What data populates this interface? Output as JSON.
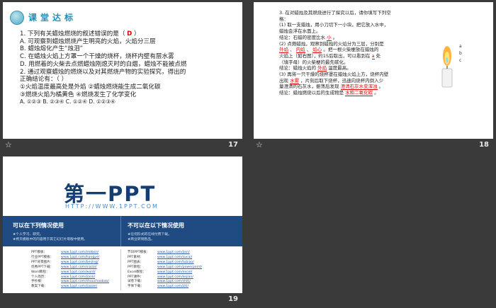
{
  "slide17": {
    "number": "17",
    "title": "课堂达标",
    "q1": "1. 下列有关蜡烛燃烧的叙述错误的是（",
    "q1_answer": "D",
    "q1_close": "）",
    "optA": "A. 可观察到蜡烛燃烧产生明亮的火焰，火焰分三层",
    "optB": "B. 蜡烛熔化产生“烛泪”",
    "optC": "C. 在蜡烛火焰上方罩一个干燥的烧杯，烧杯内壁有层水雾",
    "optD": "D. 用燃着的火柴去点燃蜡烛刚熄灭时的白烟，蜡烛不能被点燃",
    "q2a": "2. 通过观察蜡烛的燃烧以及对其燃烧产物的实验探究，得出的",
    "q2b": "正确结论有：（      ）",
    "c1": "①火焰温度最高处是外焰    ②蜡烛燃烧能生成二氧化碳",
    "c2": "③燃烧火焰为橘黄色            ④燃烧发生了化学变化",
    "opts": "A. ①②③          B. ②③④          C. ①②④          D. ①②③④"
  },
  "slide18": {
    "number": "18",
    "lines": [
      "3. 在对蜡烛及其燃烧进行了探究以后，请你填写下列空",
      "格：",
      "(1) 取一支蜡烛，用小刀切下一小块，把它放入水中，",
      "蜡烛会浮在水面上。",
      "结论：石蜡的密度比水____。",
      "(2) 点燃蜡烛，观察到蜡烛的火焰分为三层，分别是",
      "____、____、____。把一根火柴梗放在蜡烛的",
      "火焰上（如右图），约1S后取出，可以看到在____处",
      "（填字母）的火柴梗的最先碳化。",
      "结论：蜡烛火焰的____温度最高。",
      "(3) 再将一只干燥的烧杯罩在蜡烛火焰上方，烧杯内壁",
      "出现____，片刻后取下烧杯，迅速向烧杯内倒入少",
      "量澄清的石灰水，振荡后发现______________。",
      "结论：蜡烛燃烧以后的生成物是____________。"
    ],
    "fill_ans1": "小",
    "fill_outer": "外焰",
    "fill_inner": "内焰",
    "fill_core": "焰心",
    "fill_a": "a",
    "fill_outer2": "外焰",
    "fill_water": "水雾",
    "fill_limewater": "澄清石灰水变浑浊",
    "fill_products": "水和二氧化碳",
    "candle_labels": [
      "a",
      "b",
      "c"
    ]
  },
  "slide19": {
    "number": "19",
    "logo": "第一PPT",
    "url": "HTTP://WWW.1PPT.COM",
    "left_title": "可以在下列情况使用",
    "left_notes": [
      "★个人学习、研究。",
      "★拷贝模板中的内容用于其它幻灯片母版中使用。"
    ],
    "right_title": "不可以在以下情况使用",
    "right_notes": [
      "★任何形式的在线付费下载。",
      "★商业转销售品。"
    ],
    "left_list": [
      [
        "PPT模板：",
        "www.1ppt.com/moban/"
      ],
      [
        "行业PPT模板：",
        "www.1ppt.com/hangye/"
      ],
      [
        "PPT背景图片：",
        "www.1ppt.com/beijing/"
      ],
      [
        "优秀PPT下载：",
        "www.1ppt.com/xiazai/"
      ],
      [
        "Word教程：",
        "www.1ppt.com/word/"
      ],
      [
        "个人简历：",
        "www.1ppt.com/jianli/"
      ],
      [
        "手抄报：",
        "www.1ppt.com/shouchaobao/"
      ],
      [
        "教案下载：",
        "www.1ppt.com/jiaoan/"
      ]
    ],
    "right_list": [
      [
        "节日PPT模板：",
        "www.1ppt.com/jieri/"
      ],
      [
        "PPT素材：",
        "www.1ppt.com/sucai/"
      ],
      [
        "PPT图表：",
        "www.1ppt.com/tubiao/"
      ],
      [
        "PPT教程：",
        "www.1ppt.com/powerpoint/"
      ],
      [
        "Excel教程：",
        "www.1ppt.com/excel/"
      ],
      [
        "PPT课件：",
        "www.1ppt.com/kejian/"
      ],
      [
        "试卷下载：",
        "www.1ppt.com/shiti/"
      ],
      [
        "字体下载：",
        "www.1ppt.com/ziti/"
      ]
    ]
  }
}
